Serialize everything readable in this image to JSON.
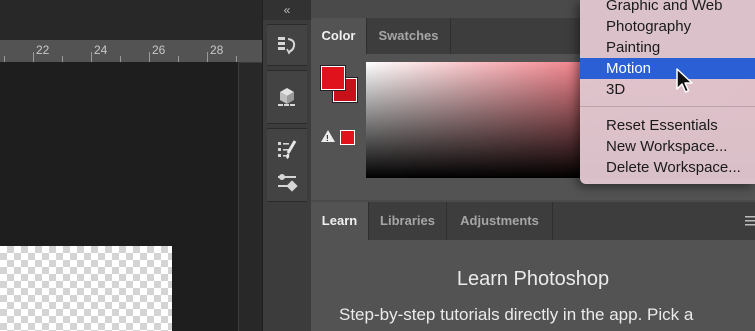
{
  "ruler": {
    "labels": [
      "22",
      "24",
      "26",
      "28"
    ]
  },
  "panel_dock": {
    "collapse_glyph": "«",
    "icons": [
      "history-icon",
      "3d-object-icon",
      "properties-list-icon",
      "brush-icon",
      "brush-settings-icon"
    ]
  },
  "color_panel": {
    "tabs": [
      {
        "label": "Color",
        "active": true
      },
      {
        "label": "Swatches",
        "active": false
      }
    ],
    "foreground_color": "#e0121b",
    "background_color": "#c8101a",
    "gamut_warning": "!",
    "field_hue": "#e81d2d"
  },
  "workspace_menu": {
    "items": [
      {
        "label": "Graphic and Web"
      },
      {
        "label": "Photography"
      },
      {
        "label": "Painting"
      },
      {
        "label": "Motion",
        "selected": true
      },
      {
        "label": "3D"
      }
    ],
    "actions": [
      {
        "label": "Reset Essentials"
      },
      {
        "label": "New Workspace..."
      },
      {
        "label": "Delete Workspace..."
      }
    ]
  },
  "learn_panel": {
    "tabs": [
      {
        "label": "Learn",
        "active": true
      },
      {
        "label": "Libraries",
        "active": false
      },
      {
        "label": "Adjustments",
        "active": false
      }
    ],
    "title": "Learn Photoshop",
    "subtitle": "Step-by-step tutorials directly in the app. Pick a"
  },
  "colors": {
    "selection": "#2b5fd6",
    "accent_red": "#e0121b"
  }
}
